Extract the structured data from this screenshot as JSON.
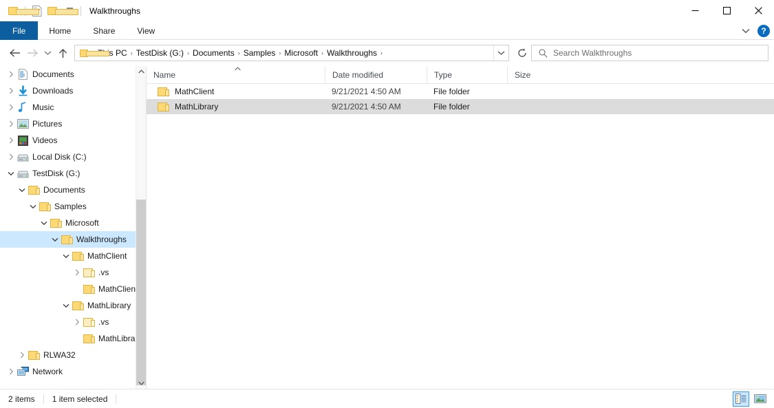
{
  "window": {
    "title": "Walkthroughs",
    "quick_access": [
      "folder-icon",
      "properties-icon",
      "new-folder-icon",
      "customize-chevron-icon"
    ],
    "controls": {
      "minimize": "—",
      "maximize": "□",
      "close": "✕"
    }
  },
  "ribbon": {
    "tabs": [
      {
        "label": "File",
        "active": true
      },
      {
        "label": "Home",
        "active": false
      },
      {
        "label": "Share",
        "active": false
      },
      {
        "label": "View",
        "active": false
      }
    ],
    "expand_icon": "chevron-down-icon",
    "help_label": "?"
  },
  "addressbar": {
    "back_icon": "←",
    "forward_icon": "→",
    "recent_icon": "˅",
    "up_icon": "↑",
    "dropdown_icon": "˅",
    "refresh_icon": "↻",
    "crumbs": [
      "This PC",
      "TestDisk (G:)",
      "Documents",
      "Samples",
      "Microsoft",
      "Walkthroughs"
    ],
    "separator": "›"
  },
  "search": {
    "icon": "search-icon",
    "placeholder": "Search Walkthroughs"
  },
  "nav": {
    "items": [
      {
        "label": "Documents",
        "indent": 0,
        "expander": "collapsed",
        "icon": "documents-icon",
        "selected": false
      },
      {
        "label": "Downloads",
        "indent": 0,
        "expander": "collapsed",
        "icon": "downloads-icon",
        "selected": false
      },
      {
        "label": "Music",
        "indent": 0,
        "expander": "collapsed",
        "icon": "music-icon",
        "selected": false
      },
      {
        "label": "Pictures",
        "indent": 0,
        "expander": "collapsed",
        "icon": "pictures-icon",
        "selected": false
      },
      {
        "label": "Videos",
        "indent": 0,
        "expander": "collapsed",
        "icon": "videos-icon",
        "selected": false
      },
      {
        "label": "Local Disk (C:)",
        "indent": 0,
        "expander": "collapsed",
        "icon": "drive-icon",
        "selected": false
      },
      {
        "label": "TestDisk (G:)",
        "indent": 0,
        "expander": "expanded",
        "icon": "drive-icon",
        "selected": false
      },
      {
        "label": "Documents",
        "indent": 1,
        "expander": "expanded",
        "icon": "folder-icon",
        "selected": false
      },
      {
        "label": "Samples",
        "indent": 2,
        "expander": "expanded",
        "icon": "folder-icon",
        "selected": false
      },
      {
        "label": "Microsoft",
        "indent": 3,
        "expander": "expanded",
        "icon": "folder-icon",
        "selected": false
      },
      {
        "label": "Walkthroughs",
        "indent": 4,
        "expander": "expanded",
        "icon": "folder-icon",
        "selected": true
      },
      {
        "label": "MathClient",
        "indent": 5,
        "expander": "expanded",
        "icon": "folder-icon",
        "selected": false
      },
      {
        "label": ".vs",
        "indent": 6,
        "expander": "collapsed",
        "icon": "folder-pale-icon",
        "selected": false
      },
      {
        "label": "MathClient",
        "indent": 6,
        "expander": "none",
        "icon": "folder-icon",
        "selected": false
      },
      {
        "label": "MathLibrary",
        "indent": 5,
        "expander": "expanded",
        "icon": "folder-icon",
        "selected": false
      },
      {
        "label": ".vs",
        "indent": 6,
        "expander": "collapsed",
        "icon": "folder-pale-icon",
        "selected": false
      },
      {
        "label": "MathLibrary",
        "indent": 6,
        "expander": "none",
        "icon": "folder-icon",
        "selected": false
      },
      {
        "label": "RLWA32",
        "indent": 1,
        "expander": "collapsed",
        "icon": "folder-icon",
        "selected": false
      },
      {
        "label": "Network",
        "indent": 0,
        "expander": "collapsed",
        "icon": "network-icon",
        "selected": false
      }
    ],
    "scrollbar": {
      "up_arrow": "˄",
      "down_arrow": "˅"
    }
  },
  "filelist": {
    "columns": [
      {
        "label": "Name",
        "sorted": "asc"
      },
      {
        "label": "Date modified",
        "sorted": ""
      },
      {
        "label": "Type",
        "sorted": ""
      },
      {
        "label": "Size",
        "sorted": ""
      }
    ],
    "sort_caret": "˄",
    "rows": [
      {
        "name": "MathClient",
        "date": "9/21/2021 4:50 AM",
        "type": "File folder",
        "size": "",
        "selected": false
      },
      {
        "name": "MathLibrary",
        "date": "9/21/2021 4:50 AM",
        "type": "File folder",
        "size": "",
        "selected": true
      }
    ]
  },
  "statusbar": {
    "item_count": "2 items",
    "selection": "1 item selected",
    "views": [
      {
        "name": "details-view",
        "active": true
      },
      {
        "name": "large-icons-view",
        "active": false
      }
    ]
  }
}
